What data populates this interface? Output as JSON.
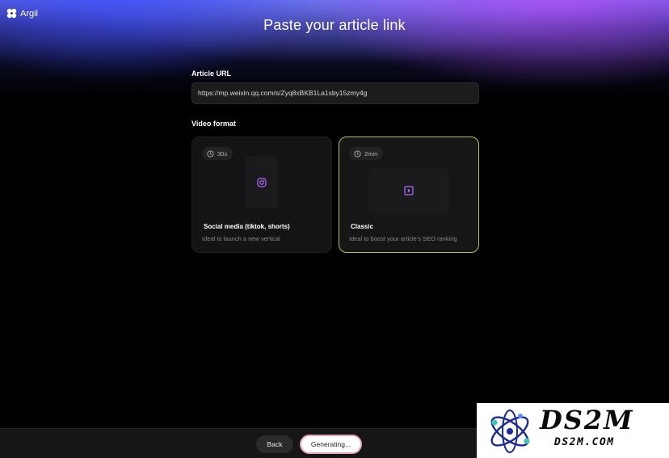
{
  "app": {
    "logo_text": "Argil"
  },
  "header": {
    "title": "Paste your article link"
  },
  "article_url": {
    "label": "Article URL",
    "value": "https://mp.weixin.qq.com/s/Zyq8xBKB1La1sby15zmy4g"
  },
  "video_format": {
    "label": "Video format",
    "options": [
      {
        "duration": "30s",
        "title": "Social media (tiktok, shorts)",
        "description": "Ideal to launch a new vertical",
        "icon": "instagram-icon",
        "selected": false
      },
      {
        "duration": "2min",
        "title": "Classic",
        "description": "Ideal to boost your article's SEO ranking",
        "icon": "play-icon",
        "selected": true
      }
    ]
  },
  "footer": {
    "back_label": "Back",
    "generate_label": "Generating..."
  },
  "watermark": {
    "title": "DS2M",
    "subtitle": "DS2M.COM"
  },
  "colors": {
    "selected_border": "#b6c24c",
    "accent_purple": "#9b5cff",
    "generate_border": "#e7a6b3"
  }
}
